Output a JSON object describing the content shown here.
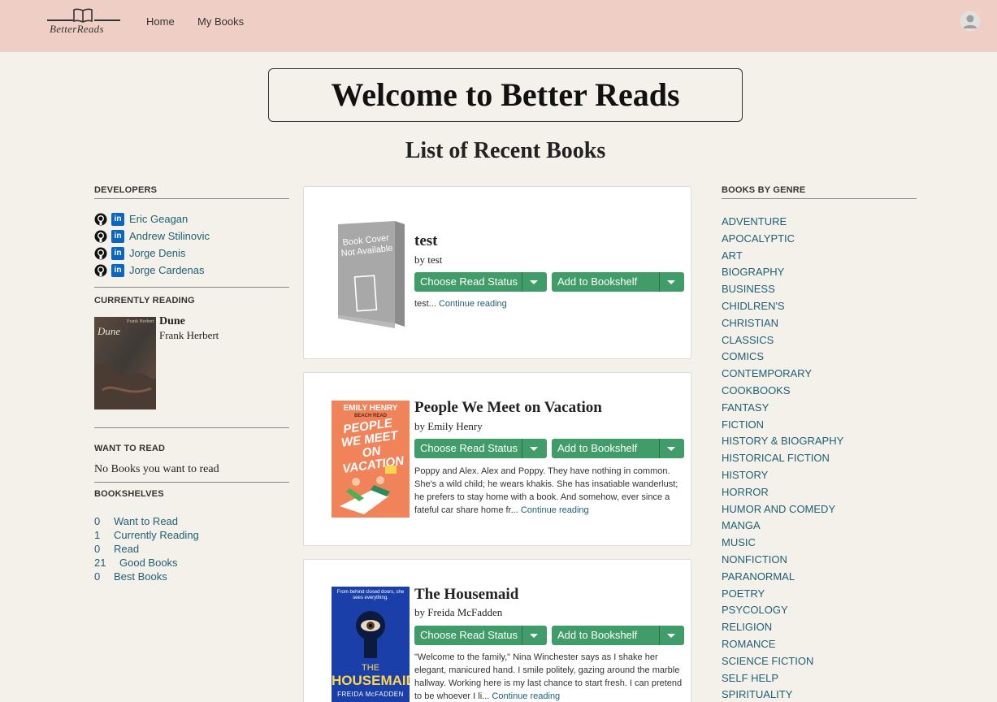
{
  "header": {
    "logo_text": "BetterReads",
    "nav": [
      "Home",
      "My Books"
    ]
  },
  "welcome": "Welcome to Better Reads",
  "section_title": "List of Recent Books",
  "left": {
    "developers_head": "DEVELOPERS",
    "developers": [
      "Eric Geagan",
      "Andrew Stilinovic",
      "Jorge Denis",
      "Jorge Cardenas"
    ],
    "currently_reading_head": "CURRENTLY READING",
    "current_book": {
      "title": "Dune",
      "author": "Frank Herbert",
      "cover_author": "Frank Herbert",
      "cover_title": "Dune"
    },
    "want_to_read_head": "WANT TO READ",
    "want_to_read_empty": "No Books you want to read",
    "bookshelves_head": "BOOKSHELVES",
    "shelves": [
      {
        "count": "0",
        "name": "Want to Read"
      },
      {
        "count": "1",
        "name": "Currently Reading"
      },
      {
        "count": "0",
        "name": "Read"
      },
      {
        "count": "21",
        "name": "Good Books"
      },
      {
        "count": "0",
        "name": "Best Books"
      }
    ]
  },
  "books": [
    {
      "title": "test",
      "author": "by test",
      "read_status_label": "Choose Read Status",
      "bookshelf_label": "Add to Bookshelf",
      "desc": "test...",
      "continue": "Continue reading",
      "cover_placeholder": "Book Cover Not Available"
    },
    {
      "title": "People We Meet on Vacation",
      "author": "by Emily Henry",
      "read_status_label": "Choose Read Status",
      "bookshelf_label": "Add to Bookshelf",
      "desc": "Poppy and Alex. Alex and Poppy. They have nothing in common. She's a wild child; he wears khakis. She has insatiable wanderlust; he prefers to stay home with a book. And somehow, ever since a fateful car share home fr...",
      "continue": "Continue reading",
      "cover_top": "EMILY HENRY",
      "cover_sub": "BEACH READ",
      "cover_title": "PEOPLE WE MEET ON VACATION"
    },
    {
      "title": "The Housemaid",
      "author": "by Freida McFadden",
      "read_status_label": "Choose Read Status",
      "bookshelf_label": "Add to Bookshelf",
      "desc": "\"Welcome to the family,\" Nina Winchester says as I shake her elegant, manicured hand. I smile politely, gazing around the marble hallway. Working here is my last chance to start fresh. I can pretend to be whoever I li...",
      "continue": "Continue reading",
      "cover_tag": "From behind closed doors, she sees everything.",
      "cover_the": "THE",
      "cover_title": "HOUSEMAID",
      "cover_author": "FREIDA McFADDEN"
    }
  ],
  "right": {
    "head": "BOOKS BY GENRE",
    "genres": [
      "ADVENTURE",
      "APOCALYPTIC",
      "ART",
      "BIOGRAPHY",
      "BUSINESS",
      "CHIDLREN'S",
      "CHRISTIAN",
      "CLASSICS",
      "COMICS",
      "CONTEMPORARY",
      "COOKBOOKS",
      "FANTASY",
      "FICTION",
      "HISTORY & BIOGRAPHY",
      "HISTORICAL FICTION",
      "HISTORY",
      "HORROR",
      "HUMOR AND COMEDY",
      "MANGA",
      "MUSIC",
      "NONFICTION",
      "PARANORMAL",
      "POETRY",
      "PSYCOLOGY",
      "RELIGION",
      "ROMANCE",
      "SCIENCE FICTION",
      "SELF HELP",
      "SPIRITUALITY"
    ]
  },
  "colors": {
    "navbar": "#efcfc5",
    "background": "#f4f1ea",
    "button": "#409d69",
    "link": "#1f5f74"
  }
}
